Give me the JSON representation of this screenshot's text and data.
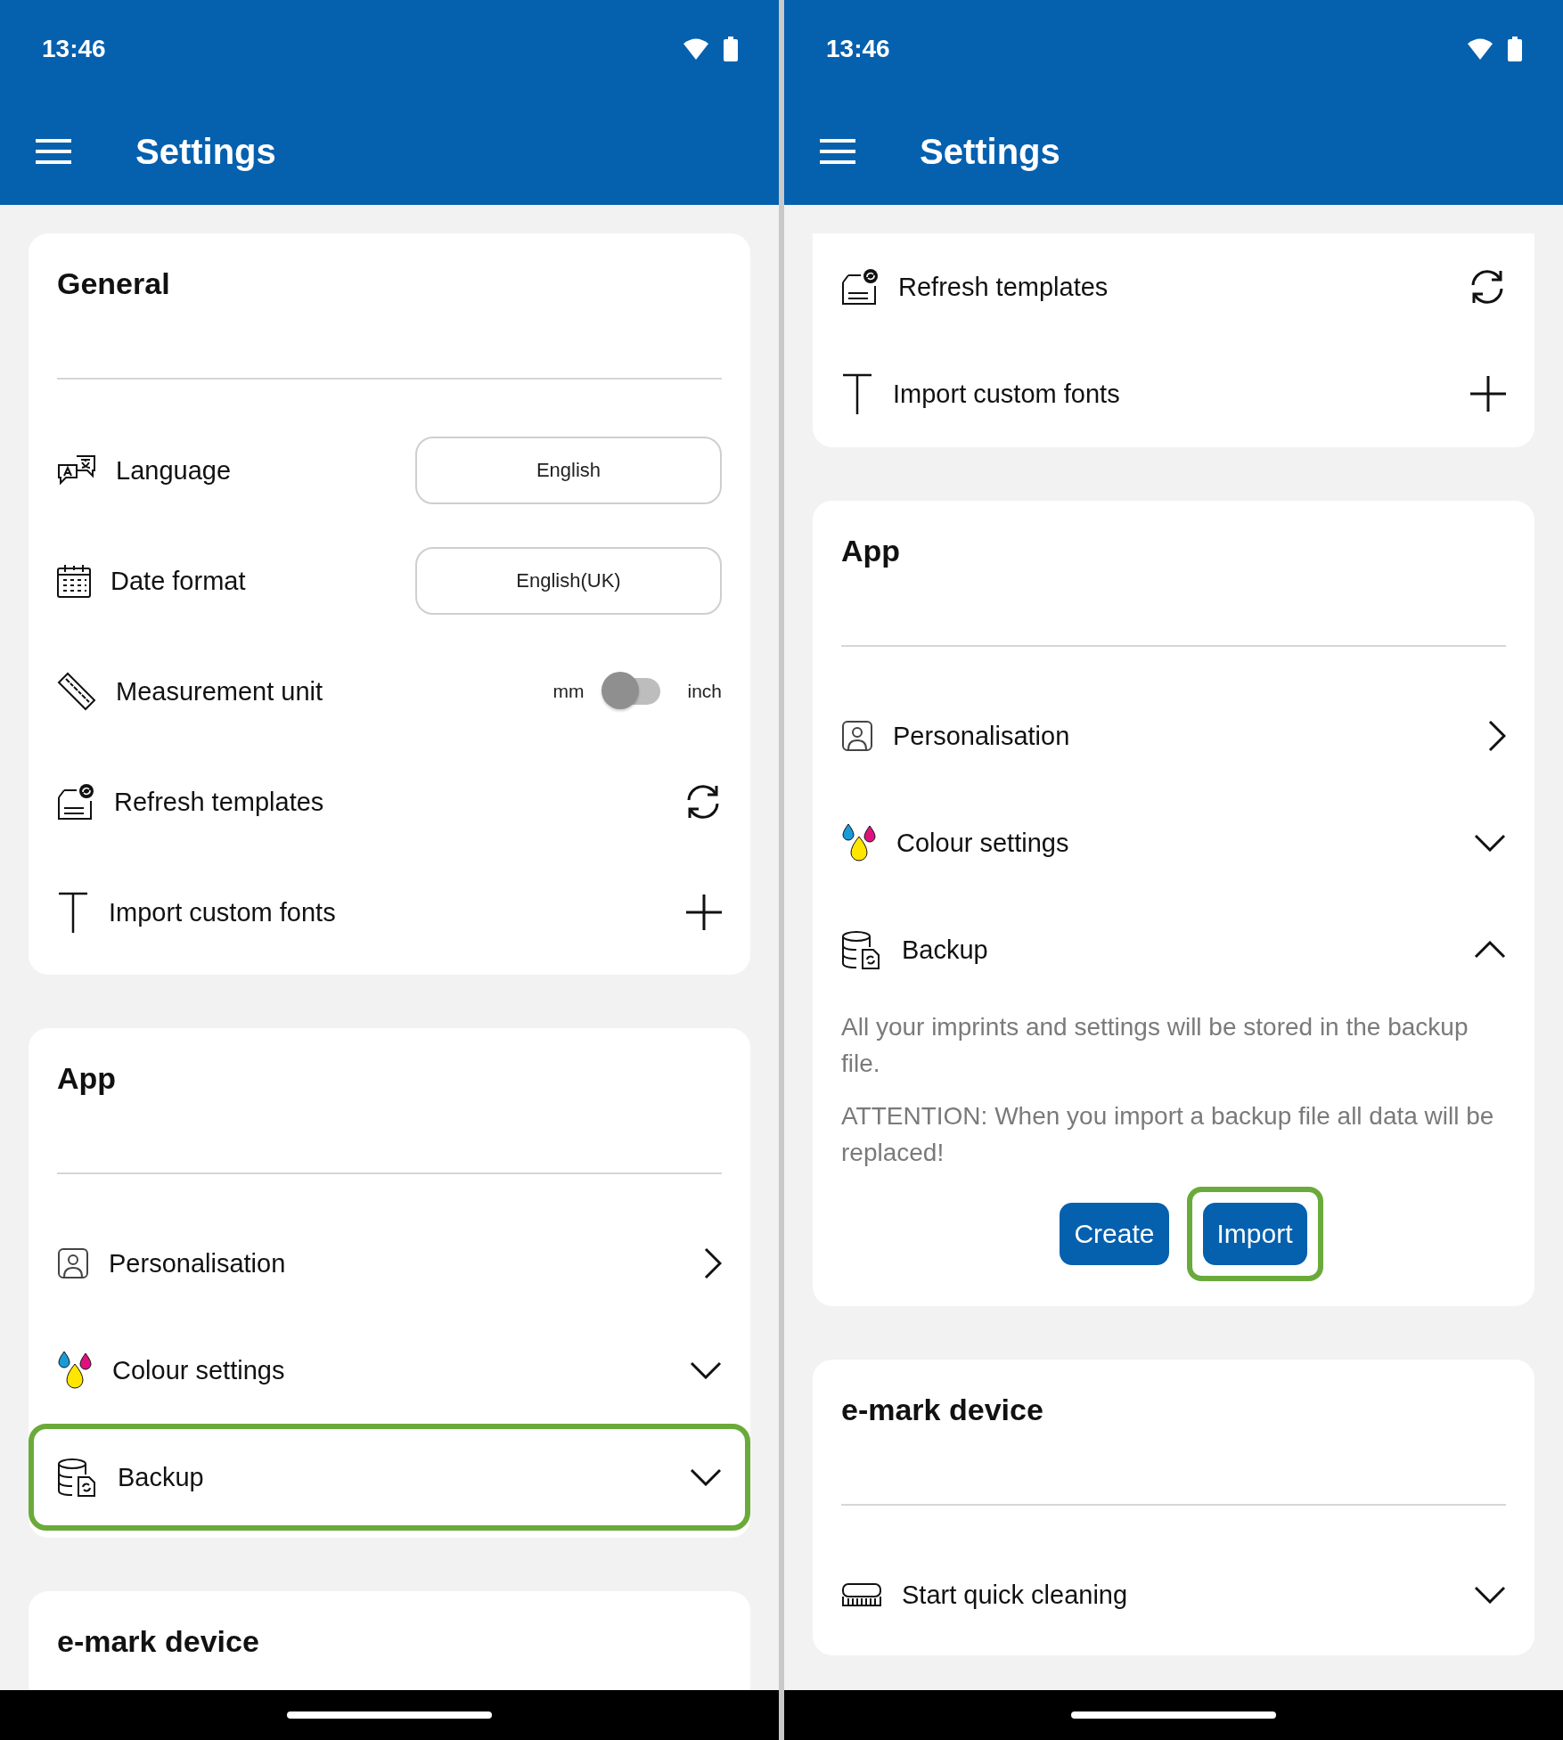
{
  "panels": [
    {
      "status_bar": {
        "time": "13:46"
      },
      "app_bar": {
        "title": "Settings"
      },
      "sections": [
        {
          "title": "General",
          "rows": [
            {
              "kind": "language",
              "label": "Language",
              "value": "English",
              "highlighted": false
            },
            {
              "kind": "dateformat",
              "label": "Date format",
              "value": "English(UK)",
              "highlighted": false
            },
            {
              "kind": "unit",
              "label": "Measurement unit",
              "off_label": "mm",
              "on_label": "inch",
              "on": false,
              "highlighted": false
            },
            {
              "kind": "refresh",
              "label": "Refresh templates",
              "highlighted": false
            },
            {
              "kind": "fonts",
              "label": "Import custom fonts",
              "highlighted": false
            }
          ]
        },
        {
          "title": "App",
          "rows": [
            {
              "kind": "personalisation",
              "label": "Personalisation",
              "highlighted": false
            },
            {
              "kind": "colour",
              "label": "Colour settings",
              "expanded": false,
              "highlighted": false
            },
            {
              "kind": "backup",
              "label": "Backup",
              "expanded": false,
              "highlighted": true
            }
          ]
        },
        {
          "title": "e-mark device"
        }
      ]
    },
    {
      "status_bar": {
        "time": "13:46"
      },
      "app_bar": {
        "title": "Settings"
      },
      "sections": [
        {
          "rows": [
            {
              "kind": "refresh",
              "label": "Refresh templates",
              "highlighted": false
            },
            {
              "kind": "fonts",
              "label": "Import custom fonts",
              "highlighted": false
            }
          ]
        },
        {
          "title": "App",
          "rows": [
            {
              "kind": "personalisation",
              "label": "Personalisation",
              "highlighted": false
            },
            {
              "kind": "colour",
              "label": "Colour settings",
              "expanded": false,
              "highlighted": false
            },
            {
              "kind": "backup",
              "label": "Backup",
              "expanded": true,
              "highlighted": false,
              "description": [
                "All your imprints and settings will be stored in the backup file.",
                "ATTENTION: When you import a backup file all data will be replaced!"
              ],
              "buttons": [
                {
                  "label": "Create",
                  "highlighted": false
                },
                {
                  "label": "Import",
                  "highlighted": true
                }
              ]
            }
          ]
        },
        {
          "title": "e-mark device",
          "rows": [
            {
              "kind": "cleaning",
              "label": "Start quick cleaning",
              "expanded": false,
              "highlighted": false
            }
          ]
        }
      ]
    }
  ]
}
